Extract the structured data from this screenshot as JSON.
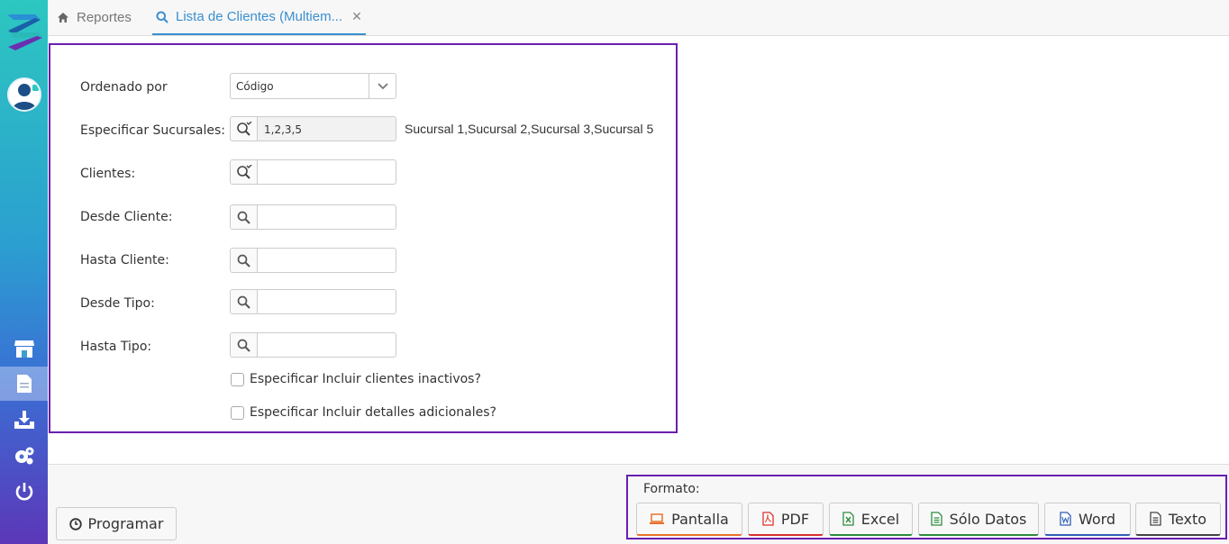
{
  "tabs": [
    {
      "label": "Reportes",
      "icon": "home-icon"
    },
    {
      "label": "Lista de Clientes (Multiem...",
      "icon": "search-icon"
    }
  ],
  "form": {
    "ordenado_por": {
      "label": "Ordenado por",
      "value": "Código"
    },
    "sucursales": {
      "label": "Especificar Sucursales:",
      "value": "1,2,3,5",
      "hint": "Sucursal 1,Sucursal 2,Sucursal 3,Sucursal 5"
    },
    "clientes": {
      "label": "Clientes:",
      "value": ""
    },
    "desde_cliente": {
      "label": "Desde Cliente:",
      "value": ""
    },
    "hasta_cliente": {
      "label": "Hasta Cliente:",
      "value": ""
    },
    "desde_tipo": {
      "label": "Desde Tipo:",
      "value": ""
    },
    "hasta_tipo": {
      "label": "Hasta Tipo:",
      "value": ""
    },
    "chk_inactivos": {
      "label": "Especificar Incluir clientes inactivos?",
      "checked": false
    },
    "chk_detalles": {
      "label": "Especificar Incluir detalles adicionales?",
      "checked": false
    }
  },
  "programar_label": "Programar",
  "formato": {
    "label": "Formato:",
    "buttons": [
      {
        "label": "Pantalla",
        "color": "#e8722c"
      },
      {
        "label": "PDF",
        "color": "#d9302c"
      },
      {
        "label": "Excel",
        "color": "#2e8b3a"
      },
      {
        "label": "Sólo Datos",
        "color": "#2e8b3a"
      },
      {
        "label": "Word",
        "color": "#2f5fb3"
      },
      {
        "label": "Texto",
        "color": "#444444"
      }
    ]
  },
  "colors": {
    "accent": "#3a8fd0",
    "highlight_border": "#6a1fb0"
  }
}
